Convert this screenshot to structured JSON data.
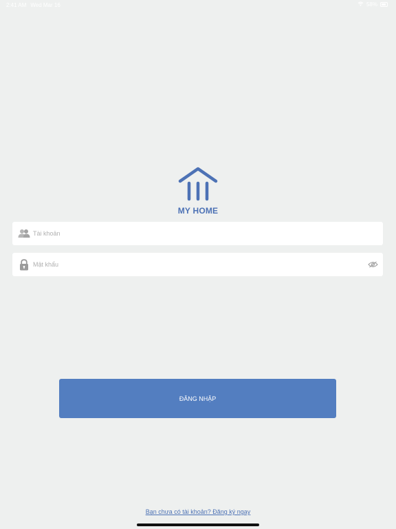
{
  "status_bar": {
    "time": "2:41 AM",
    "date": "Wed Mar 16",
    "battery": "58%",
    "wifi_icon": "wifi-icon",
    "battery_icon": "battery-icon"
  },
  "app": {
    "title": "MY HOME",
    "logo_icon": "home-icon",
    "brand_color": "#4d72b5"
  },
  "form": {
    "username": {
      "placeholder": "Tài khoản",
      "value": "",
      "icon": "users-icon"
    },
    "password": {
      "placeholder": "Mật khẩu",
      "value": "",
      "icon": "lock-icon",
      "toggle_icon": "eye-hidden-icon"
    }
  },
  "login_button": {
    "label": "ĐĂNG NHẬP",
    "color": "#537ec0"
  },
  "register": {
    "text": "Bạn chưa có tài khoản? Đăng ký ngay"
  }
}
